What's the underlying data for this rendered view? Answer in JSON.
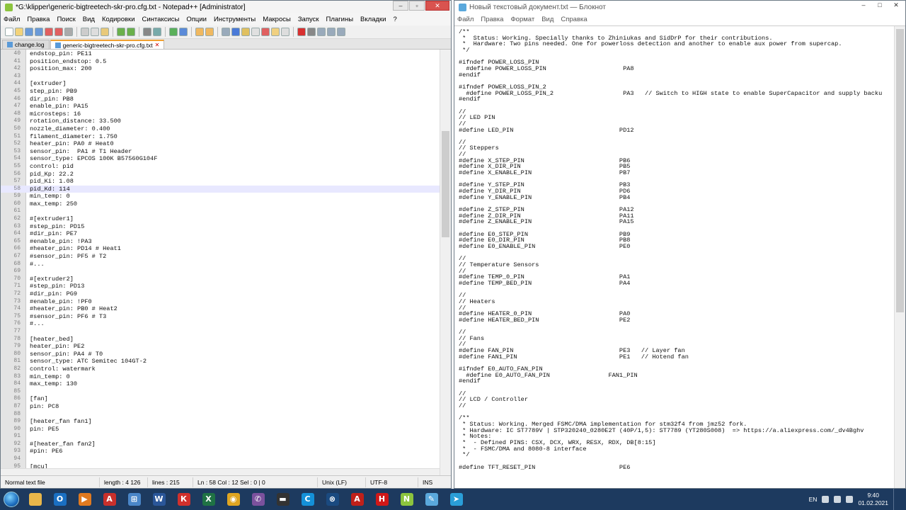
{
  "npp": {
    "title": "*G:\\klipper\\generic-bigtreetech-skr-pro.cfg.txt - Notepad++ [Administrator]",
    "menu": [
      "Файл",
      "Правка",
      "Поиск",
      "Вид",
      "Кодировки",
      "Синтаксисы",
      "Опции",
      "Инструменты",
      "Макросы",
      "Запуск",
      "Плагины",
      "Вкладки",
      "?"
    ],
    "tabs": [
      {
        "label": "change.log",
        "active": false
      },
      {
        "label": "generic-bigtreetech-skr-pro.cfg.txt",
        "active": true
      }
    ],
    "current_line": 58,
    "lines": [
      {
        "n": "40",
        "t": "endstop_pin: PE11"
      },
      {
        "n": "41",
        "t": "position_endstop: 0.5"
      },
      {
        "n": "42",
        "t": "position_max: 200"
      },
      {
        "n": "43",
        "t": ""
      },
      {
        "n": "44",
        "t": "[extruder]"
      },
      {
        "n": "45",
        "t": "step_pin: PB9"
      },
      {
        "n": "46",
        "t": "dir_pin: PB8"
      },
      {
        "n": "47",
        "t": "enable_pin: PA15"
      },
      {
        "n": "48",
        "t": "microsteps: 16"
      },
      {
        "n": "49",
        "t": "rotation_distance: 33.500"
      },
      {
        "n": "50",
        "t": "nozzle_diameter: 0.400"
      },
      {
        "n": "51",
        "t": "filament_diameter: 1.750"
      },
      {
        "n": "52",
        "t": "heater_pin: PA0 # Heat0"
      },
      {
        "n": "53",
        "t": "sensor_pin:  PA1 # T1 Header"
      },
      {
        "n": "54",
        "t": "sensor_type: EPCOS 100K B57560G104F"
      },
      {
        "n": "55",
        "t": "control: pid"
      },
      {
        "n": "56",
        "t": "pid_Kp: 22.2"
      },
      {
        "n": "57",
        "t": "pid_Ki: 1.08"
      },
      {
        "n": "58",
        "t": "pid_Kd: 114"
      },
      {
        "n": "59",
        "t": "min_temp: 0"
      },
      {
        "n": "60",
        "t": "max_temp: 250"
      },
      {
        "n": "61",
        "t": ""
      },
      {
        "n": "62",
        "t": "#[extruder1]"
      },
      {
        "n": "63",
        "t": "#step_pin: PD15"
      },
      {
        "n": "64",
        "t": "#dir_pin: PE7"
      },
      {
        "n": "65",
        "t": "#enable_pin: !PA3"
      },
      {
        "n": "66",
        "t": "#heater_pin: PD14 # Heat1"
      },
      {
        "n": "67",
        "t": "#sensor_pin: PF5 # T2"
      },
      {
        "n": "68",
        "t": "#..."
      },
      {
        "n": "69",
        "t": ""
      },
      {
        "n": "70",
        "t": "#[extruder2]"
      },
      {
        "n": "71",
        "t": "#step_pin: PD13"
      },
      {
        "n": "72",
        "t": "#dir_pin: PG9"
      },
      {
        "n": "73",
        "t": "#enable_pin: !PF0"
      },
      {
        "n": "74",
        "t": "#heater_pin: PB0 # Heat2"
      },
      {
        "n": "75",
        "t": "#sensor_pin: PF6 # T3"
      },
      {
        "n": "76",
        "t": "#..."
      },
      {
        "n": "77",
        "t": ""
      },
      {
        "n": "78",
        "t": "[heater_bed]"
      },
      {
        "n": "79",
        "t": "heater_pin: PE2"
      },
      {
        "n": "80",
        "t": "sensor_pin: PA4 # T0"
      },
      {
        "n": "81",
        "t": "sensor_type: ATC Semitec 104GT-2"
      },
      {
        "n": "82",
        "t": "control: watermark"
      },
      {
        "n": "83",
        "t": "min_temp: 0"
      },
      {
        "n": "84",
        "t": "max_temp: 130"
      },
      {
        "n": "85",
        "t": ""
      },
      {
        "n": "86",
        "t": "[fan]"
      },
      {
        "n": "87",
        "t": "pin: PC8"
      },
      {
        "n": "88",
        "t": ""
      },
      {
        "n": "89",
        "t": "[heater_fan fan1]"
      },
      {
        "n": "90",
        "t": "pin: PE5"
      },
      {
        "n": "91",
        "t": ""
      },
      {
        "n": "92",
        "t": "#[heater_fan fan2]"
      },
      {
        "n": "93",
        "t": "#pin: PE6"
      },
      {
        "n": "94",
        "t": ""
      },
      {
        "n": "95",
        "t": "[mcu]"
      }
    ],
    "status": {
      "type": "Normal text file",
      "length": "length : 4 126",
      "lines": "lines : 215",
      "pos": "Ln : 58   Col : 12   Sel : 0 | 0",
      "eol": "Unix (LF)",
      "enc": "UTF-8",
      "ins": "INS"
    }
  },
  "notepad": {
    "title": "Новый текстовый документ.txt — Блокнот",
    "menu": [
      "Файл",
      "Правка",
      "Формат",
      "Вид",
      "Справка"
    ],
    "lines": [
      "/**",
      " *  Status: Working. Specially thanks to Zhiniukas and SidDrP for their contributions.",
      " *  Hardware: Two pins needed. One for powerloss detection and another to enable aux power from supercap.",
      " */",
      "",
      "#ifndef POWER_LOSS_PIN",
      "  #define POWER_LOSS_PIN                     PA8",
      "#endif",
      "",
      "#ifndef POWER_LOSS_PIN_2",
      "  #define POWER_LOSS_PIN_2                   PA3   // Switch to HIGH state to enable SuperCapacitor and supply backu",
      "#endif",
      "",
      "//",
      "// LED PIN",
      "//",
      "#define LED_PIN                             PD12",
      "",
      "//",
      "// Steppers",
      "//",
      "#define X_STEP_PIN                          PB6",
      "#define X_DIR_PIN                           PB5",
      "#define X_ENABLE_PIN                        PB7",
      "",
      "#define Y_STEP_PIN                          PB3",
      "#define Y_DIR_PIN                           PD6",
      "#define Y_ENABLE_PIN                        PB4",
      "",
      "#define Z_STEP_PIN                          PA12",
      "#define Z_DIR_PIN                           PA11",
      "#define Z_ENABLE_PIN                        PA15",
      "",
      "#define E0_STEP_PIN                         PB9",
      "#define E0_DIR_PIN                          PB8",
      "#define E0_ENABLE_PIN                       PE0",
      "",
      "//",
      "// Temperature Sensors",
      "//",
      "#define TEMP_0_PIN                          PA1",
      "#define TEMP_BED_PIN                        PA4",
      "",
      "//",
      "// Heaters",
      "//",
      "#define HEATER_0_PIN                        PA0",
      "#define HEATER_BED_PIN                      PE2",
      "",
      "//",
      "// Fans",
      "//",
      "#define FAN_PIN                             PE3   // Layer fan",
      "#define FAN1_PIN                            PE1   // Hotend fan",
      "",
      "#ifndef E0_AUTO_FAN_PIN",
      "  #define E0_AUTO_FAN_PIN                FAN1_PIN",
      "#endif",
      "",
      "//",
      "// LCD / Controller",
      "//",
      "",
      "/**",
      " * Status: Working. Merged FSMC/DMA implementation for stm32f4 from jmz52 fork.",
      " * Hardware: IC ST7789V | STP320240_0280E2T (40P/1,5): ST7789 (YT280S008)  => https://a.aliexpress.com/_dv4Bghv",
      " * Notes:",
      " *  - Defined PINS: CSX, DCX, WRX, RESX, RDX, DB[8:15]",
      " *  - FSMC/DMA and 8080-8 interface",
      " */",
      "",
      "#define TFT_RESET_PIN                       PE6"
    ]
  },
  "taskbar": {
    "apps": [
      {
        "name": "explorer-icon",
        "color": "#e8b64a",
        "glyph": ""
      },
      {
        "name": "outlook-icon",
        "color": "#1a6fc2",
        "glyph": "O"
      },
      {
        "name": "media-player-icon",
        "color": "#e07a20",
        "glyph": "▶"
      },
      {
        "name": "app-red-icon",
        "color": "#c8302c",
        "glyph": "A"
      },
      {
        "name": "network-icon",
        "color": "#4a86c8",
        "glyph": "⊞"
      },
      {
        "name": "word-icon",
        "color": "#2a5699",
        "glyph": "W"
      },
      {
        "name": "app-stamp-icon",
        "color": "#d0302c",
        "glyph": "К"
      },
      {
        "name": "excel-icon",
        "color": "#1f7244",
        "glyph": "X"
      },
      {
        "name": "chrome-icon",
        "color": "#dfa521",
        "glyph": "◉"
      },
      {
        "name": "viber-icon",
        "color": "#7b519d",
        "glyph": "✆"
      },
      {
        "name": "app-dark-icon",
        "color": "#333333",
        "glyph": "▬"
      },
      {
        "name": "app-blue-c-icon",
        "color": "#1490d8",
        "glyph": "C"
      },
      {
        "name": "app-circle-icon",
        "color": "#1a4a80",
        "glyph": "⊗"
      },
      {
        "name": "acrobat-icon",
        "color": "#c0201a",
        "glyph": "A"
      },
      {
        "name": "app-h-icon",
        "color": "#d01818",
        "glyph": "H"
      },
      {
        "name": "notepadpp-icon",
        "color": "#8cc43e",
        "glyph": "N"
      },
      {
        "name": "notepad-icon",
        "color": "#5aa8dc",
        "glyph": "✎"
      },
      {
        "name": "telegram-icon",
        "color": "#2a9ed8",
        "glyph": "➤"
      }
    ],
    "lang": "EN",
    "time": "9:40",
    "date": "01.02.2021"
  }
}
